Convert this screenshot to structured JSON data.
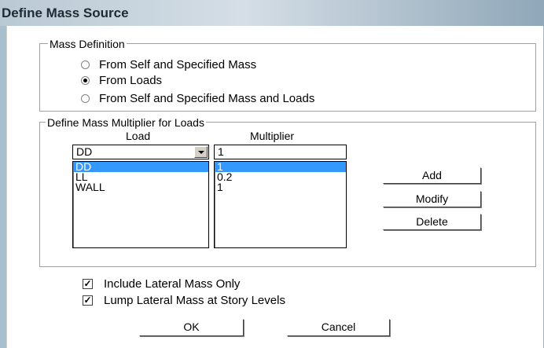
{
  "window": {
    "title": "Define Mass Source"
  },
  "mass_definition": {
    "group_label": "Mass Definition",
    "options": [
      {
        "label": "From Self and Specified Mass",
        "selected": false
      },
      {
        "label": "From Loads",
        "selected": true
      },
      {
        "label": "From Self and Specified Mass and Loads",
        "selected": false
      }
    ]
  },
  "multiplier_group": {
    "group_label": "Define Mass Multiplier for Loads",
    "load_header": "Load",
    "multiplier_header": "Multiplier",
    "load_select_value": "DD",
    "multiplier_value": "1",
    "loads": [
      "DD",
      "LL",
      "WALL"
    ],
    "multipliers": [
      "1",
      "0.2",
      "1"
    ],
    "selected_index": 0,
    "buttons": {
      "add": "Add",
      "modify": "Modify",
      "delete": "Delete"
    }
  },
  "options": {
    "include_lateral": {
      "label": "Include Lateral Mass Only",
      "checked": true
    },
    "lump_lateral": {
      "label": "Lump Lateral Mass at Story Levels",
      "checked": true
    }
  },
  "footer": {
    "ok": "OK",
    "cancel": "Cancel"
  }
}
